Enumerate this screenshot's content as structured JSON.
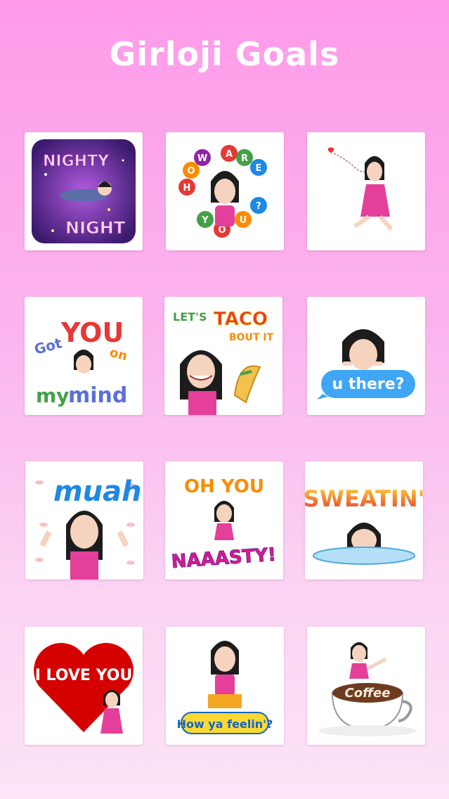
{
  "header": {
    "title": "Girloji Goals"
  },
  "stickers": [
    {
      "id": "nighty-night",
      "lines": [
        "NIGHTY",
        "NIGHT"
      ]
    },
    {
      "id": "how-are-you",
      "letters": [
        "H",
        "O",
        "W",
        "A",
        "R",
        "E",
        "Y",
        "O",
        "U",
        "?"
      ]
    },
    {
      "id": "blowing-kiss"
    },
    {
      "id": "got-you-on-my-mind",
      "words": [
        "Got",
        "YOU",
        "on",
        "my",
        "mind"
      ]
    },
    {
      "id": "lets-taco-bout-it",
      "words": [
        "LET'S",
        "TACO",
        "BOUT IT"
      ]
    },
    {
      "id": "u-there",
      "bubble": "u there?"
    },
    {
      "id": "muah",
      "word": "muah"
    },
    {
      "id": "oh-you-naaasty",
      "words": [
        "OH YOU",
        "NAAASTY!"
      ]
    },
    {
      "id": "sweatin",
      "word": "SWEATIN'"
    },
    {
      "id": "i-love-you",
      "word": "I LOVE YOU"
    },
    {
      "id": "how-ya-feelin",
      "sign": "How ya feelin'?"
    },
    {
      "id": "coffee",
      "word": "Coffee"
    }
  ],
  "colors": {
    "accent_pink": "#e43f9a",
    "hair": "#1c1c1c",
    "skin": "#f6d3bf",
    "ios_blue": "#3ea6f5"
  }
}
